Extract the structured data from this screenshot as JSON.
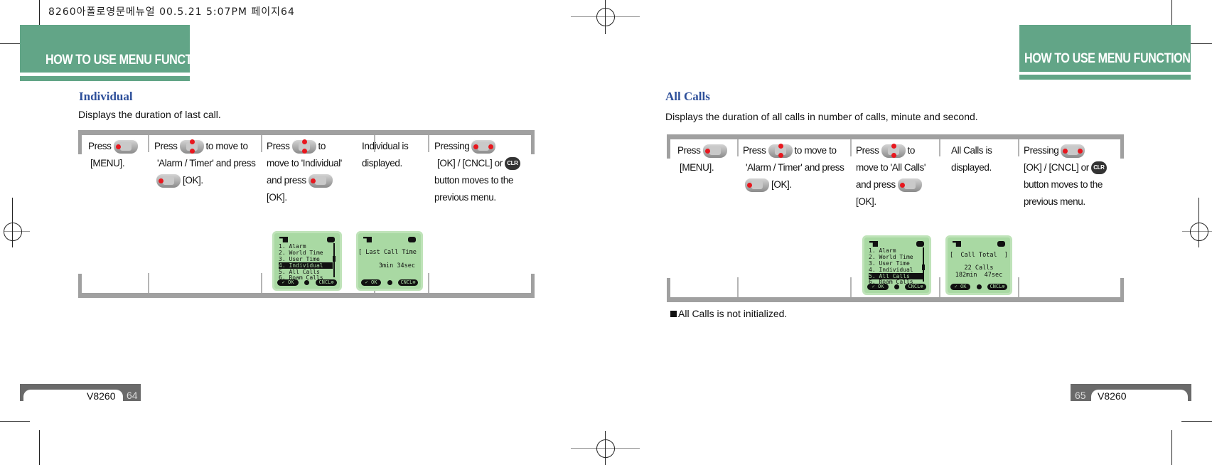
{
  "print_slug": "8260아폴로영문메뉴얼   00.5.21 5:07PM 페이지64",
  "left_page": {
    "header": "HOW TO USE MENU FUNCTIONS",
    "section_title": "Individual",
    "description": "Displays the duration of last call.",
    "steps": [
      {
        "line1_pre": "Press",
        "line1_post": "",
        "rest": [
          "[MENU]."
        ],
        "key": "menu-key-icon"
      },
      {
        "line1_pre": "Press",
        "line1_post": "to move to",
        "rest": [
          "'Alarm / Timer' and press",
          "[OK]."
        ],
        "key": "nav-key-icon"
      },
      {
        "line1_pre": "Press",
        "line1_post": "to",
        "rest": [
          "move to 'Individual'",
          "and press",
          "[OK]."
        ],
        "key": "nav-key-icon"
      },
      {
        "line1_pre": "Individual is",
        "line1_post": "",
        "rest": [
          "displayed."
        ],
        "key": ""
      },
      {
        "line1_pre": "Pressing",
        "line1_post": "",
        "rest": [
          "[OK] / [CNCL] or",
          "button moves to the",
          "previous menu."
        ],
        "key": "ok-cncl-key-icon"
      }
    ],
    "menu_screen": {
      "items": [
        "1. Alarm",
        "2. World Time",
        "3. User Time",
        "4. Individual",
        "5. All Calls",
        "6. Roam Calls"
      ],
      "highlighted": "4. Individual",
      "softkey_left": "✓ OK",
      "softkey_right": "CNCL⊗"
    },
    "result_screen": {
      "title": "[ Last Call Time ]",
      "line1": "3min 34sec",
      "softkey_left": "✓ OK",
      "softkey_right": "CNCL⊗"
    },
    "footer_model": "V8260",
    "footer_page": "64"
  },
  "right_page": {
    "header": "HOW TO USE MENU FUNCTIONS",
    "section_title": "All Calls",
    "description": "Displays the duration of all calls in number of calls, minute and second.",
    "steps": [
      {
        "line1_pre": "Press",
        "line1_post": "",
        "rest": [
          "[MENU]."
        ],
        "key": "menu-key-icon"
      },
      {
        "line1_pre": "Press",
        "line1_post": "to move to",
        "rest": [
          "'Alarm / Timer' and press",
          "[OK]."
        ],
        "key": "nav-key-icon"
      },
      {
        "line1_pre": "Press",
        "line1_post": "to",
        "rest": [
          "move to  'All Calls'",
          "and press",
          "[OK]."
        ],
        "key": "nav-key-icon"
      },
      {
        "line1_pre": "All Calls is",
        "line1_post": "",
        "rest": [
          "displayed."
        ],
        "key": ""
      },
      {
        "line1_pre": "Pressing",
        "line1_post": "",
        "rest": [
          "[OK] / [CNCL] or",
          "button moves to the",
          "previous menu."
        ],
        "key": "ok-cncl-key-icon"
      }
    ],
    "menu_screen": {
      "items": [
        "1. Alarm",
        "2. World Time",
        "3. User Time",
        "4. Individual",
        "5. All Calls",
        "6. Roam Calls"
      ],
      "highlighted": "5. All Calls",
      "softkey_left": "✓ OK",
      "softkey_right": "CNCL⊗"
    },
    "result_screen": {
      "title": "[  Call Total  ]",
      "line1": "22 Calls",
      "line2": "182min  47sec",
      "softkey_left": "✓ OK",
      "softkey_right": "CNCL⊗"
    },
    "note": "All Calls is not initialized.",
    "footer_model": "V8260",
    "footer_page": "65"
  },
  "clr_label": "CLR",
  "colors": {
    "header_green": "#62a587",
    "title_blue": "#2d4f9a",
    "lcd_green": "#a9d9a3",
    "key_red": "#e8171e",
    "table_grey": "#a0a0a0"
  }
}
